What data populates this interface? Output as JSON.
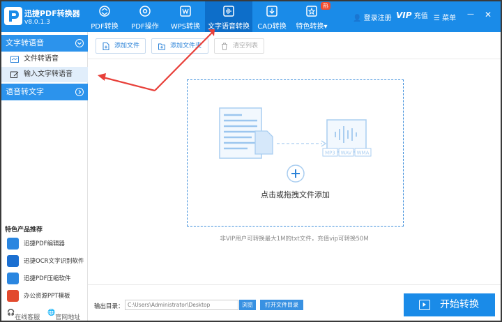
{
  "header": {
    "app_name": "迅捷PDF转换器",
    "version": "v8.0.1.3",
    "nav": [
      {
        "label": "PDF转换",
        "icon": "refresh-icon"
      },
      {
        "label": "PDF操作",
        "icon": "gear-icon"
      },
      {
        "label": "WPS转换",
        "icon": "wps-icon"
      },
      {
        "label": "文字语音转换",
        "icon": "audio-wave-icon",
        "active": true
      },
      {
        "label": "CAD转换",
        "icon": "cad-icon"
      },
      {
        "label": "特色转换▾",
        "icon": "star-icon",
        "badge": "热"
      }
    ],
    "login": "登录注册",
    "vip": "VIP",
    "vip_suffix": "充值",
    "menu": "菜单"
  },
  "sidebar": {
    "sections": [
      {
        "title": "文字转语音",
        "items": [
          {
            "label": "文件转语音",
            "icon": "folder-icon"
          },
          {
            "label": "输入文字转语音",
            "icon": "edit-icon",
            "selected": true
          }
        ]
      },
      {
        "title": "语音转文字",
        "items": []
      }
    ],
    "recommend_title": "特色产品推荐",
    "recommend": [
      {
        "label": "迅捷PDF编辑器",
        "icon": "pdf-editor-icon",
        "color": "#2a86e0"
      },
      {
        "label": "迅捷OCR文字识别软件",
        "icon": "ocr-icon",
        "color": "#1b6fd1"
      },
      {
        "label": "迅捷PDF压缩软件",
        "icon": "pdf-compress-icon",
        "color": "#2a86e0"
      },
      {
        "label": "办公资源PPT模板",
        "icon": "ppt-icon",
        "color": "#e24a2e"
      }
    ],
    "support": "在线客服",
    "website": "官网地址"
  },
  "toolbar": {
    "add_file": "添加文件",
    "add_folder": "添加文件夹",
    "clear": "清空列表"
  },
  "dropzone": {
    "formats": [
      "MP3",
      "WAV",
      "WMA"
    ],
    "text": "点击或拖拽文件添加"
  },
  "limit_note": "非VIP用户可转换最大1M的txt文件，充值vip可转换50M",
  "output": {
    "label": "输出目录：",
    "path": "C:\\Users\\Administrator\\Desktop",
    "browse": "浏览",
    "open": "打开文件目录"
  },
  "start_button": "开始转换",
  "colors": {
    "primary": "#1a8be8",
    "active_tab": "#0d6ec9",
    "arrow": "#e8403a"
  }
}
